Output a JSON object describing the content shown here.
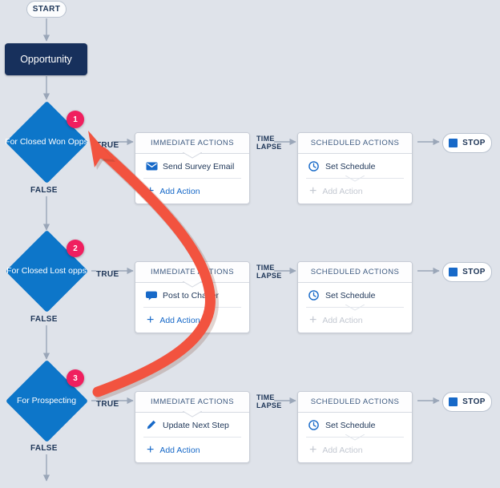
{
  "canvas": {
    "background": "#dfe3ea",
    "accent_blue": "#0d76c9",
    "link_blue": "#1769c8",
    "object_navy": "#17305c",
    "badge_pink": "#f01f5f",
    "arrow_red": "#f2533f",
    "connector_gray": "#9aa6b8"
  },
  "start": {
    "label": "START"
  },
  "object": {
    "label": "Opportunity"
  },
  "labels": {
    "true": "TRUE",
    "false": "FALSE",
    "time_lapse_line1": "TIME",
    "time_lapse_line2": "LAPSE",
    "immediate_actions": "IMMEDIATE ACTIONS",
    "scheduled_actions": "SCHEDULED ACTIONS",
    "add_action": "Add Action",
    "set_schedule": "Set Schedule",
    "stop": "STOP"
  },
  "rows": [
    {
      "badge": "1",
      "criteria_label": "For Closed Won Opps",
      "immediate_action": {
        "label": "Send Survey Email",
        "icon": "email-icon"
      },
      "scheduled_action": {
        "label": "Set Schedule",
        "icon": "clock-icon"
      },
      "stop": "STOP"
    },
    {
      "badge": "2",
      "criteria_label": "For Closed Lost opps",
      "immediate_action": {
        "label": "Post to Chatter",
        "icon": "chatter-icon"
      },
      "scheduled_action": {
        "label": "Set Schedule",
        "icon": "clock-icon"
      },
      "stop": "STOP"
    },
    {
      "badge": "3",
      "criteria_label": "For Prospecting",
      "immediate_action": {
        "label": "Update Next Step",
        "icon": "pencil-icon"
      },
      "scheduled_action": {
        "label": "Set Schedule",
        "icon": "clock-icon"
      },
      "stop": "STOP"
    }
  ],
  "annotation": {
    "type": "red-curved-arrow",
    "color": "#f2533f",
    "from": "for-prospecting-true-branch",
    "to": "for-closed-won-opps-true-branch"
  }
}
